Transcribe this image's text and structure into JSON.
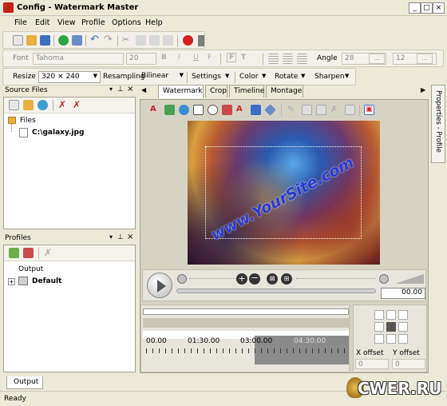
{
  "window": {
    "title": "Config - Watermark Master"
  },
  "menu": [
    "File",
    "Edit",
    "View",
    "Profile",
    "Options",
    "Help"
  ],
  "format_bar": {
    "font_label": "Font",
    "font_value": "Tahoma",
    "font_size": "20",
    "angle_label": "Angle",
    "angle_value": "28",
    "angle_btn": "...",
    "extra_value": "12",
    "extra_btn": "...",
    "bold": "B",
    "italic": "I",
    "underline": "U",
    "strike": "F",
    "font_color": "F",
    "text_color": "T"
  },
  "image_bar": {
    "resize": "Resize",
    "size": "320 × 240",
    "resampling_label": "Resampling",
    "resampling_value": "Bilinear",
    "settings": "Settings",
    "color": "Color",
    "rotate": "Rotate",
    "sharpen": "Sharpen"
  },
  "source_files": {
    "title": "Source Files",
    "root": "Files",
    "file": "C:\\galaxy.jpg"
  },
  "profiles": {
    "title": "Profiles",
    "root": "Output",
    "item": "Default"
  },
  "tabs": [
    "Watermark",
    "Crop",
    "Timeline",
    "Montage"
  ],
  "side_tab": "Properties - Profile",
  "preview": {
    "watermark_text": "www.YourSite.com"
  },
  "playback": {
    "time_value": "00.00"
  },
  "timeline": {
    "marks": [
      "00.00",
      "01:30.00",
      "03:00.00",
      "04:30.00"
    ]
  },
  "offset": {
    "x_label": "X offset",
    "y_label": "Y offset",
    "x_value": "0",
    "y_value": "0"
  },
  "bottom_tab": "Output",
  "status": "Ready",
  "watermark_logo": "CWER.RU"
}
